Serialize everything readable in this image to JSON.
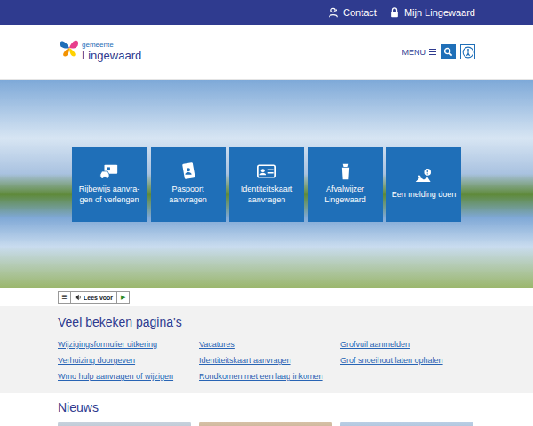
{
  "topbar": {
    "links": [
      {
        "label": "Contact",
        "icon": "contact"
      },
      {
        "label": "Mijn Lingewaard",
        "icon": "lock"
      }
    ]
  },
  "logo": {
    "small": "gemeente",
    "name": "Lingewaard"
  },
  "header": {
    "menu_label": "MENU"
  },
  "tiles": [
    {
      "label": "Rijbewijs aanvra­gen of verlengen",
      "icon": "car"
    },
    {
      "label": "Paspoort aanvragen",
      "icon": "passport"
    },
    {
      "label": "Identiteitskaart aanvragen",
      "icon": "idcard"
    },
    {
      "label": "Afvalwijzer Lingewaard",
      "icon": "bin"
    },
    {
      "label": "Een melding doen",
      "icon": "report"
    }
  ],
  "readspeaker": {
    "menu": "☰",
    "label": "Lees voor",
    "play": "▶"
  },
  "popular": {
    "title": "Veel bekeken pagina's",
    "columns": [
      [
        "Wijzigingsformulier uitkering",
        "Verhuizing doorgeven",
        "Wmo hulp aanvragen of wijzigen"
      ],
      [
        "Vacatures",
        "Identiteitskaart aanvragen",
        "Rondkomen met een laag inkomen"
      ],
      [
        "Grofvuil aanmelden",
        "Grof snoeihout laten ophalen"
      ]
    ]
  },
  "news": {
    "title": "Nieuws"
  }
}
